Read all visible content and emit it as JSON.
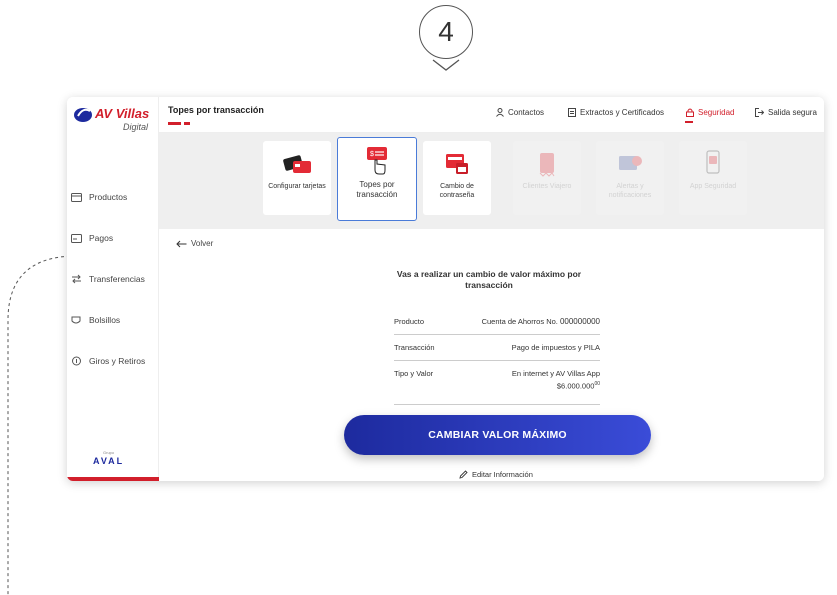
{
  "step": {
    "number": "4"
  },
  "brand": {
    "name": "AV Villas",
    "sub": "Digital",
    "group": "AVAL",
    "group_small": "Grupo"
  },
  "topbar": {
    "title": "Topes por transacción",
    "links": [
      {
        "label": "Contactos",
        "icon": "person-icon"
      },
      {
        "label": "Extractos y Certificados",
        "icon": "document-icon"
      },
      {
        "label": "Seguridad",
        "icon": "lock-icon",
        "active": true
      },
      {
        "label": "Salida segura",
        "icon": "logout-icon"
      }
    ]
  },
  "sidebar": {
    "items": [
      {
        "label": "Productos",
        "icon": "card-icon"
      },
      {
        "label": "Pagos",
        "icon": "payment-icon"
      },
      {
        "label": "Transferencias",
        "icon": "transfer-icon"
      },
      {
        "label": "Bolsillos",
        "icon": "pocket-icon"
      },
      {
        "label": "Giros y Retiros",
        "icon": "withdraw-icon"
      }
    ]
  },
  "tiles": [
    {
      "label": "Configurar tarjetas",
      "icon": "cards-config-icon",
      "state": "enabled"
    },
    {
      "label": "Topes por transacción",
      "icon": "transaction-limit-icon",
      "state": "selected"
    },
    {
      "label": "Cambio de contraseña",
      "icon": "password-change-icon",
      "state": "enabled"
    },
    {
      "label": "Clientes Viajero",
      "icon": "traveler-icon",
      "state": "disabled"
    },
    {
      "label": "Alertas y notificaciones",
      "icon": "alerts-icon",
      "state": "disabled"
    },
    {
      "label": "App Seguridad",
      "icon": "app-security-icon",
      "state": "disabled"
    }
  ],
  "content": {
    "back_label": "Volver",
    "heading": "Vas a realizar un cambio de valor máximo por transacción",
    "rows": [
      {
        "key": "Producto",
        "value_prefix": "Cuenta de Ahorros No. ",
        "value_strong": "000000000"
      },
      {
        "key": "Transacción",
        "value_prefix": "Pago de impuestos y PILA",
        "value_strong": ""
      },
      {
        "key": "Tipo y Valor",
        "value_prefix": "En internet y AV Villas App",
        "value_line2": "$6.000.000",
        "value_line2_sup": "00"
      }
    ],
    "cta_label": "CAMBIAR VALOR MÁXIMO",
    "edit_label": "Editar Información"
  },
  "colors": {
    "brand_red": "#d21f2b",
    "cta_blue": "#2536b8",
    "selected_border": "#4a7bd8"
  }
}
